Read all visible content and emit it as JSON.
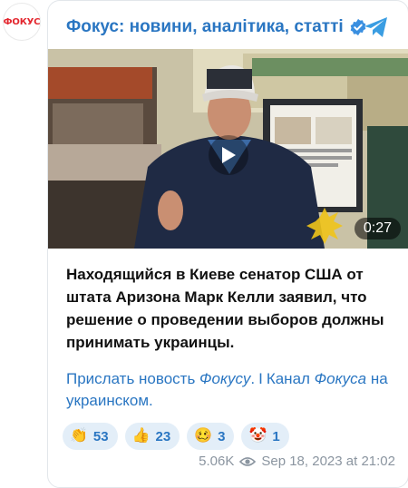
{
  "avatar": {
    "text": "ФОКУС"
  },
  "header": {
    "title": "Фокус: новини, аналітика, статті",
    "verified_icon": "verified-icon",
    "telegram_icon": "telegram-icon"
  },
  "video": {
    "duration": "0:27",
    "play_icon": "play-icon"
  },
  "post": {
    "text": "Находящийся в Киеве сенатор США от штата Аризона Марк Келли заявил, что решение о проведении выборов должны принимать украинцы.",
    "links": {
      "part1": "Прислать новость ",
      "part1_italic": "Фокусу",
      "part1_end": ".",
      "separator": "I",
      "part2": "Канал ",
      "part2_italic": "Фокуса",
      "part2_end": " на украинском."
    }
  },
  "reactions": [
    {
      "emoji": "👏",
      "count": "53"
    },
    {
      "emoji": "👍",
      "count": "23"
    },
    {
      "emoji": "🥴",
      "count": "3"
    },
    {
      "emoji": "🤡",
      "count": "1"
    }
  ],
  "meta": {
    "views": "5.06K",
    "date": "Sep 18, 2023 at 21:02"
  },
  "colors": {
    "accent": "#2a76c2",
    "brand_red": "#e3262e",
    "reaction_bg": "#e3eef8"
  }
}
